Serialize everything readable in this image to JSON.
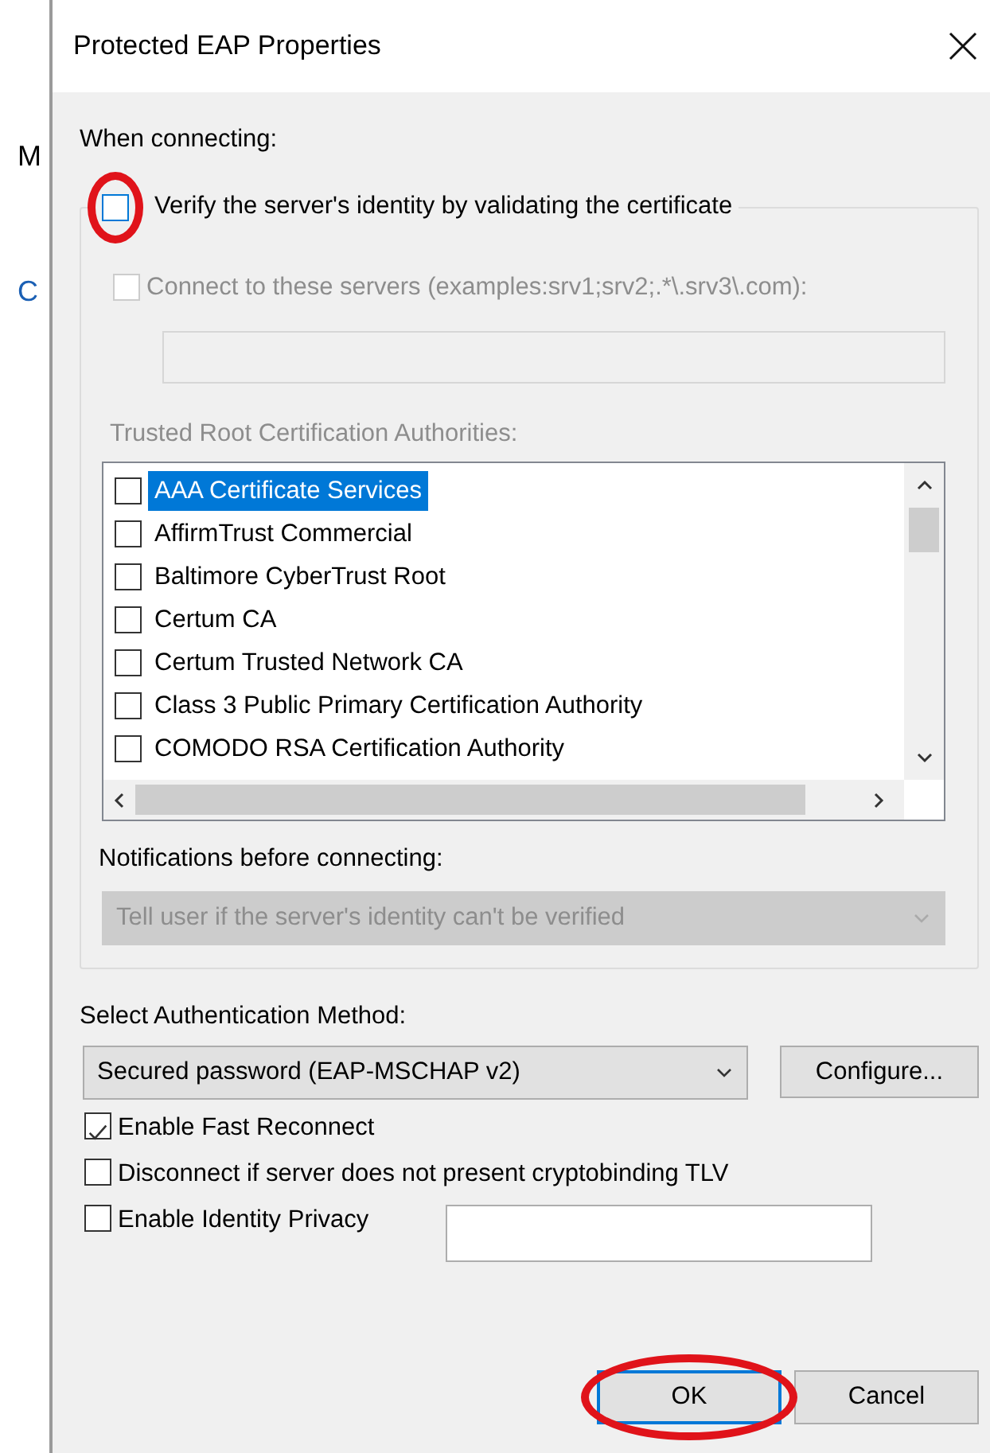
{
  "background_window": {
    "texts": [
      "M",
      "C"
    ]
  },
  "window": {
    "title": "Protected EAP Properties"
  },
  "when_connecting": {
    "label": "When connecting:",
    "verify": {
      "label": "Verify the server's identity by validating the certificate",
      "checked": false,
      "highlighted": true
    },
    "connect_servers": {
      "label": "Connect to these servers (examples:srv1;srv2;.*\\.srv3\\.com):",
      "checked": false,
      "disabled": true
    },
    "servers_field": {
      "disabled": true
    },
    "trusted_label": {
      "label": "Trusted Root Certification Authorities:",
      "disabled": true
    },
    "authorities": [
      {
        "label": "AAA Certificate Services",
        "checked": false,
        "selected": true
      },
      {
        "label": "AffirmTrust Commercial",
        "checked": false,
        "selected": false
      },
      {
        "label": "Baltimore CyberTrust Root",
        "checked": false,
        "selected": false
      },
      {
        "label": "Certum CA",
        "checked": false,
        "selected": false
      },
      {
        "label": "Certum Trusted Network CA",
        "checked": false,
        "selected": false
      },
      {
        "label": "Class 3 Public Primary Certification Authority",
        "checked": false,
        "selected": false
      },
      {
        "label": "COMODO RSA Certification Authority",
        "checked": false,
        "selected": false
      }
    ],
    "notifications": {
      "label": "Notifications before connecting:",
      "value": "Tell user if the server's identity can't be verified",
      "disabled": true
    }
  },
  "authentication": {
    "label": "Select Authentication Method:",
    "value": "Secured password (EAP-MSCHAP v2)",
    "configure": "Configure..."
  },
  "options": [
    {
      "label": "Enable Fast Reconnect",
      "checked": true,
      "has_field": false
    },
    {
      "label": "Disconnect if server does not present cryptobinding TLV",
      "checked": false,
      "has_field": false
    },
    {
      "label": "Enable Identity Privacy",
      "checked": false,
      "has_field": true
    }
  ],
  "buttons": [
    {
      "label": "OK",
      "default": true,
      "highlighted": true
    },
    {
      "label": "Cancel",
      "default": false,
      "highlighted": false
    }
  ]
}
